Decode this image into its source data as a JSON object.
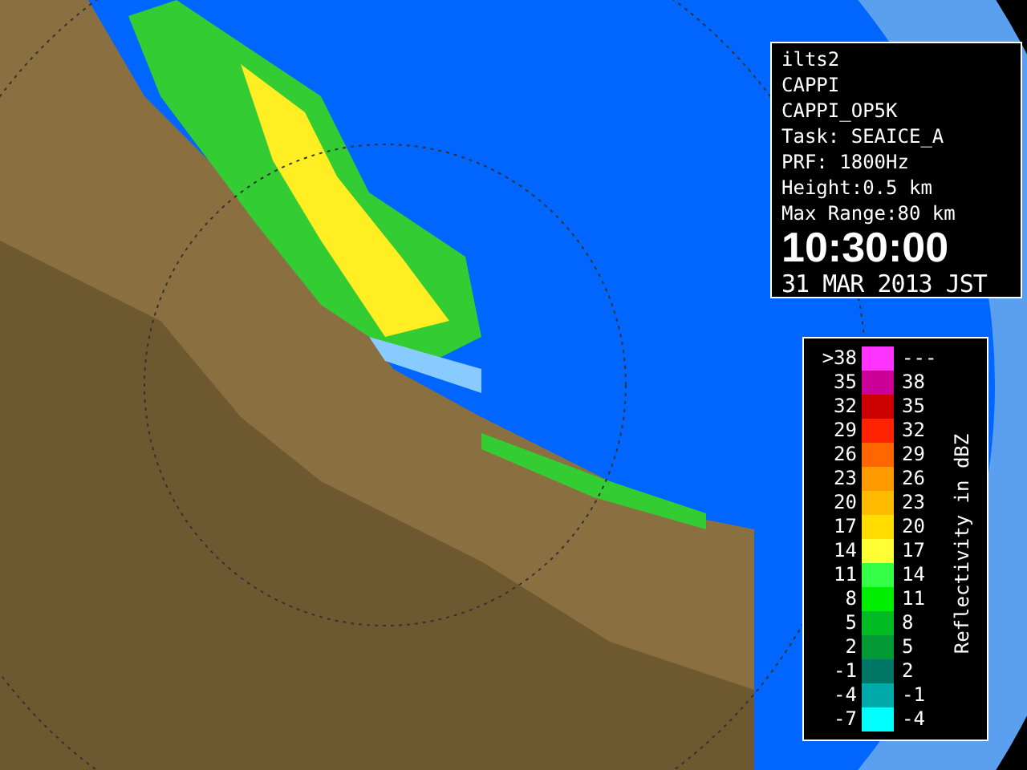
{
  "info_panel": {
    "lines": [
      "ilts2",
      "CAPPI",
      "CAPPI_OP5K",
      "Task: SEAICE_A",
      "PRF: 1800Hz",
      "Height:0.5 km",
      "Max Range:80 km"
    ],
    "time": "10:30:00",
    "date": "31 MAR 2013 JST"
  },
  "legend": {
    "title": "Reflectivity in dBZ",
    "rows": [
      {
        "low": ">38",
        "high": "---",
        "color": "#ff33ff"
      },
      {
        "low": "35",
        "high": "38",
        "color": "#cc0099"
      },
      {
        "low": "32",
        "high": "35",
        "color": "#cc0000"
      },
      {
        "low": "29",
        "high": "32",
        "color": "#ff2200"
      },
      {
        "low": "26",
        "high": "29",
        "color": "#ff6600"
      },
      {
        "low": "23",
        "high": "26",
        "color": "#ff9900"
      },
      {
        "low": "20",
        "high": "23",
        "color": "#ffbb00"
      },
      {
        "low": "17",
        "high": "20",
        "color": "#ffdd00"
      },
      {
        "low": "14",
        "high": "17",
        "color": "#ffff33"
      },
      {
        "low": "11",
        "high": "14",
        "color": "#33ff44"
      },
      {
        "low": "8",
        "high": "11",
        "color": "#00ee00"
      },
      {
        "low": "5",
        "high": "8",
        "color": "#00bb22"
      },
      {
        "low": "2",
        "high": "5",
        "color": "#009933"
      },
      {
        "low": "-1",
        "high": "2",
        "color": "#007766"
      },
      {
        "low": "-4",
        "high": "-1",
        "color": "#00aaaa"
      },
      {
        "low": "-7",
        "high": "-4",
        "color": "#00ffff"
      }
    ]
  }
}
